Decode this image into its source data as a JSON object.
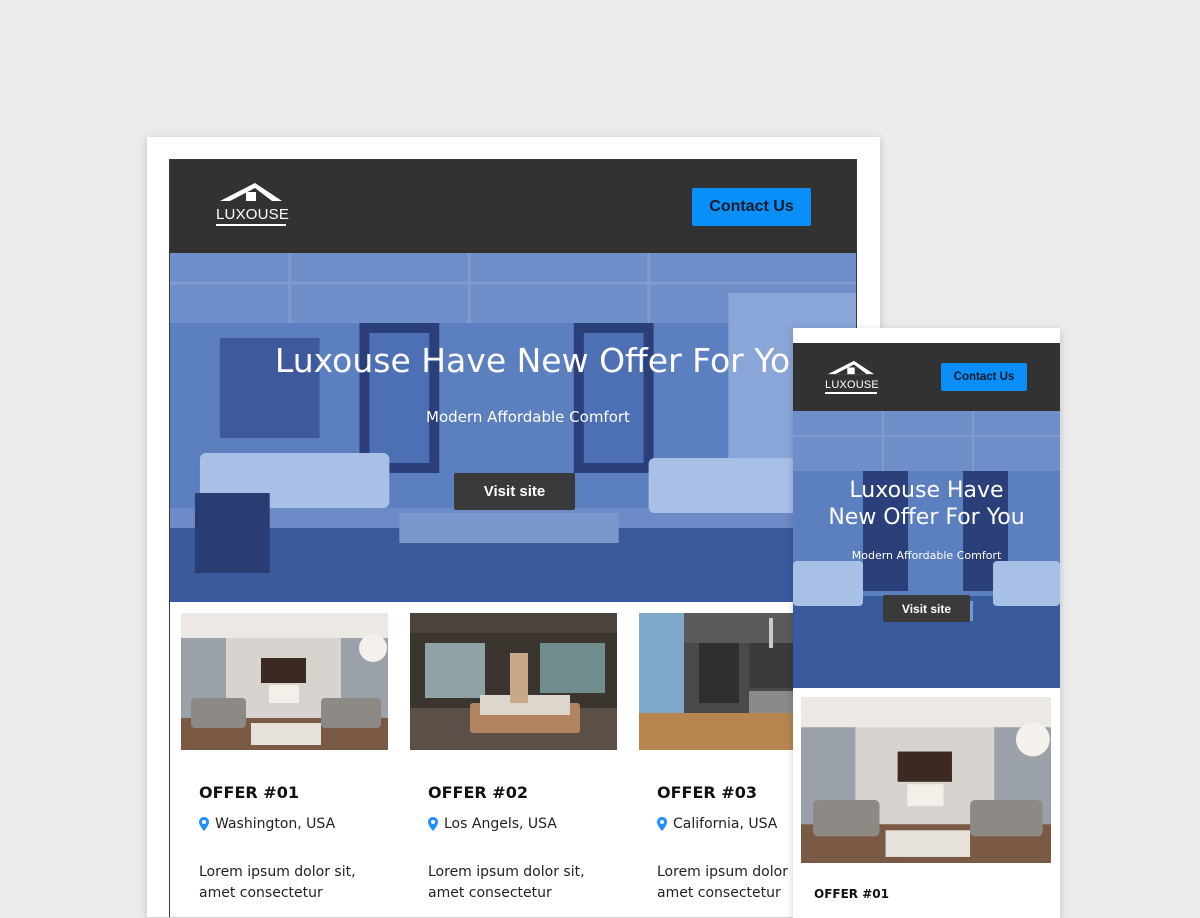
{
  "colors": {
    "page_background": "#ebebeb",
    "header_background": "#323232",
    "accent_button": "#0a8efa",
    "hero_tint": "#3f6fc0",
    "dark_button": "#3a3a3a",
    "pin_color": "#1e90ff"
  },
  "brand": {
    "logo_text": "LUXOUSE",
    "logo_icon": "house-roof-icon"
  },
  "header": {
    "contact_label": "Contact Us"
  },
  "hero": {
    "title": "Luxouse Have New Offer For You",
    "subtitle": "Modern Affordable Comfort",
    "visit_label": "Visit site"
  },
  "mobile_hero": {
    "title_line1": "Luxouse Have",
    "title_line2": "New Offer For You"
  },
  "offers": [
    {
      "title": "OFFER #01",
      "location": "Washington, USA",
      "description": "Lorem ipsum dolor sit, amet consectetur",
      "image": "living-room-photo"
    },
    {
      "title": "OFFER #02",
      "location": "Los Angels, USA",
      "description": "Lorem ipsum dolor sit, amet consectetur",
      "image": "bedroom-photo"
    },
    {
      "title": "OFFER #03",
      "location": "California, USA",
      "description": "Lorem ipsum dolor sit, amet consectetur",
      "image": "kitchen-photo"
    }
  ]
}
